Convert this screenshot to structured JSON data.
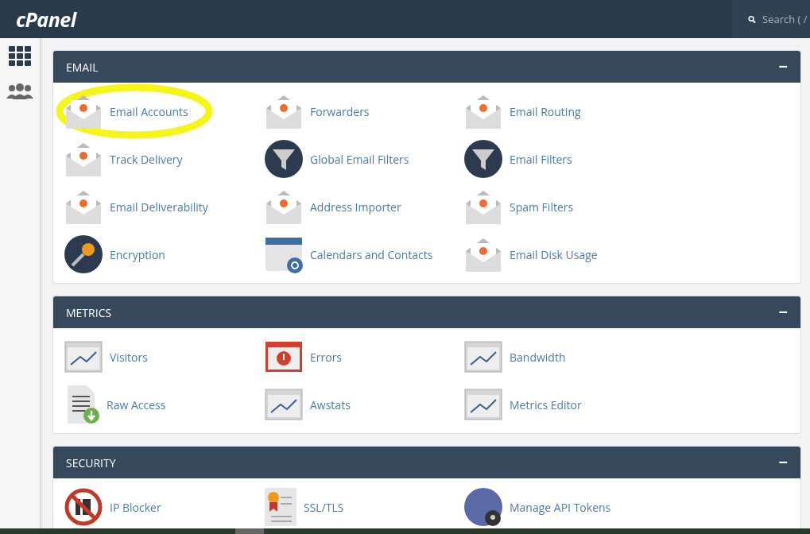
{
  "header": {
    "logo": "cPanel",
    "search": {
      "placeholder": "Search ( /"
    }
  },
  "sections": [
    {
      "title": "EMAIL",
      "collapse": "−",
      "items": [
        {
          "label": "Email Accounts",
          "kind": "envelope",
          "highlighted": true
        },
        {
          "label": "Forwarders",
          "kind": "envelope",
          "highlighted": false
        },
        {
          "label": "Email Routing",
          "kind": "envelope",
          "highlighted": false
        },
        {
          "label": "Track Delivery",
          "kind": "envelope",
          "highlighted": false
        },
        {
          "label": "Global Email Filters",
          "kind": "funnel",
          "highlighted": false
        },
        {
          "label": "Email Filters",
          "kind": "funnel",
          "highlighted": false
        },
        {
          "label": "Email Deliverability",
          "kind": "envelope",
          "highlighted": false
        },
        {
          "label": "Address Importer",
          "kind": "envelope",
          "highlighted": false
        },
        {
          "label": "Spam Filters",
          "kind": "envelope",
          "highlighted": false
        },
        {
          "label": "Encryption",
          "kind": "key",
          "highlighted": false
        },
        {
          "label": "Calendars and Contacts",
          "kind": "calendar",
          "highlighted": false
        },
        {
          "label": "Email Disk Usage",
          "kind": "envelope",
          "highlighted": false
        }
      ]
    },
    {
      "title": "METRICS",
      "collapse": "−",
      "items": [
        {
          "label": "Visitors",
          "kind": "screen",
          "highlighted": false
        },
        {
          "label": "Errors",
          "kind": "alert",
          "highlighted": false
        },
        {
          "label": "Bandwidth",
          "kind": "screen",
          "highlighted": false
        },
        {
          "label": "Raw Access",
          "kind": "document",
          "highlighted": false
        },
        {
          "label": "Awstats",
          "kind": "screen",
          "highlighted": false
        },
        {
          "label": "Metrics Editor",
          "kind": "screen",
          "highlighted": false
        }
      ]
    },
    {
      "title": "SECURITY",
      "collapse": "−",
      "items": [
        {
          "label": "IP Blocker",
          "kind": "nosign",
          "highlighted": false
        },
        {
          "label": "SSL/TLS",
          "kind": "certificate",
          "highlighted": false
        },
        {
          "label": "Manage API Tokens",
          "kind": "api",
          "highlighted": false
        }
      ]
    }
  ]
}
